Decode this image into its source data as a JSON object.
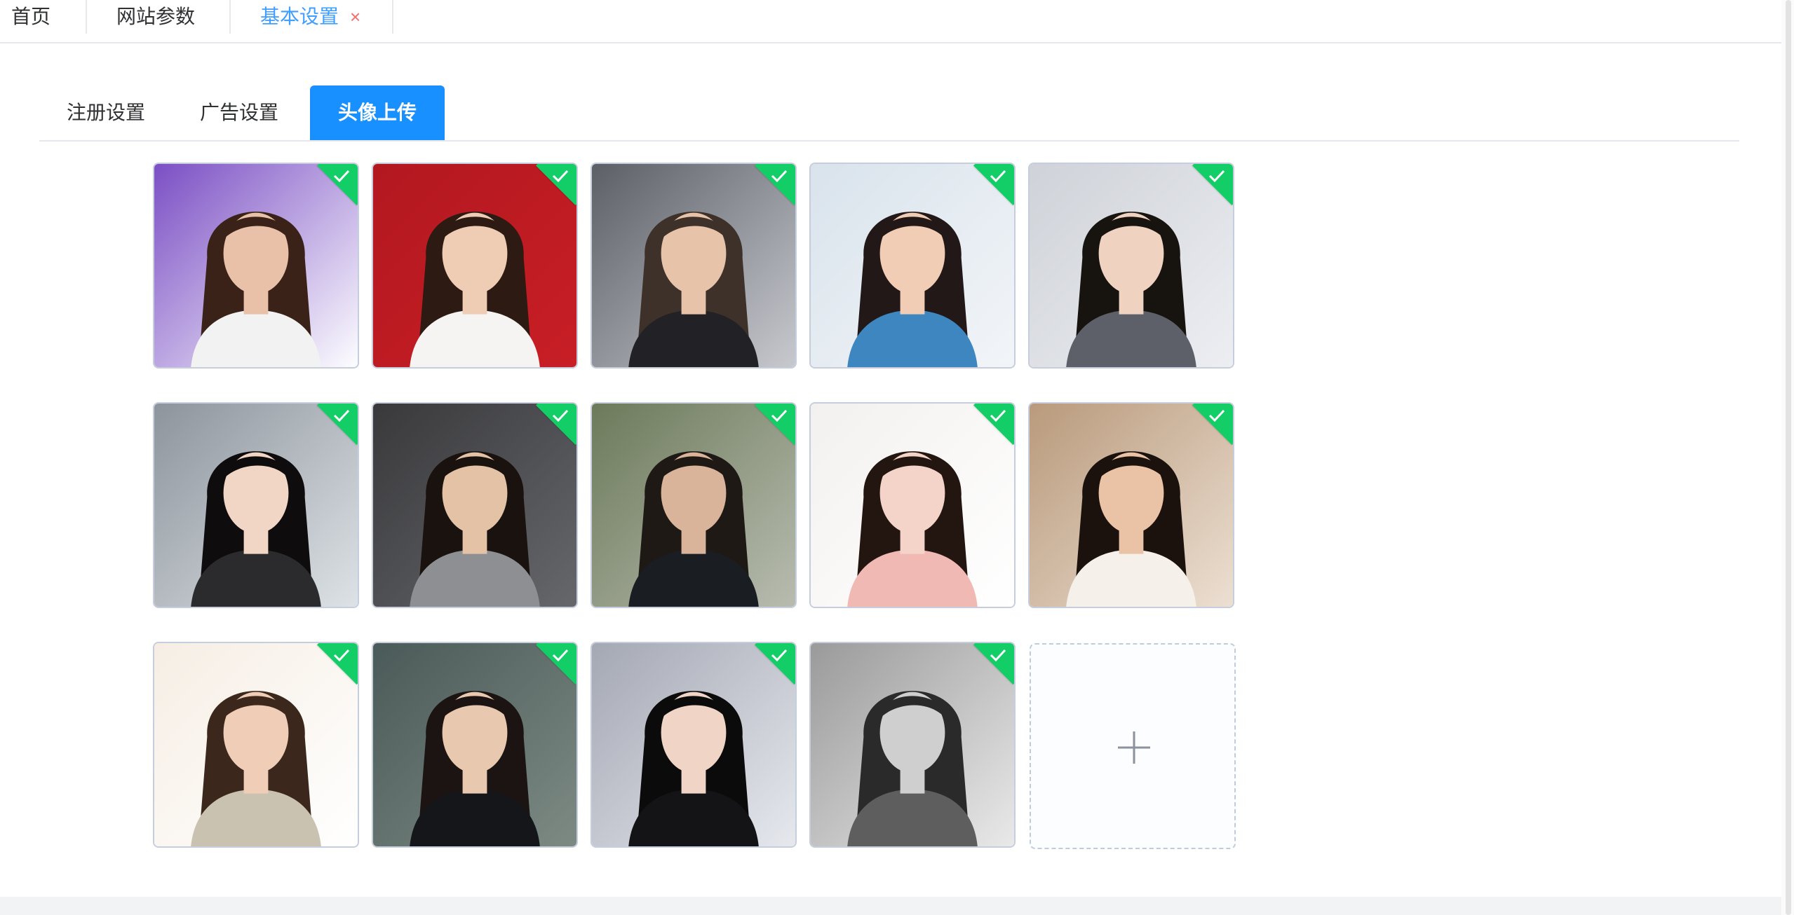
{
  "page_tabs": [
    {
      "label": "首页"
    },
    {
      "label": "网站参数"
    },
    {
      "label": "基本设置",
      "close": "×"
    }
  ],
  "subtabs": [
    {
      "label": "注册设置"
    },
    {
      "label": "广告设置"
    },
    {
      "label": "头像上传"
    }
  ],
  "active_subtab": "头像上传",
  "avatars_selected": 14,
  "colors": {
    "accent": "#1890ff",
    "active_page_tab": "#409eff",
    "close_icon": "#f56c6c",
    "check_badge": "#13ce66"
  }
}
